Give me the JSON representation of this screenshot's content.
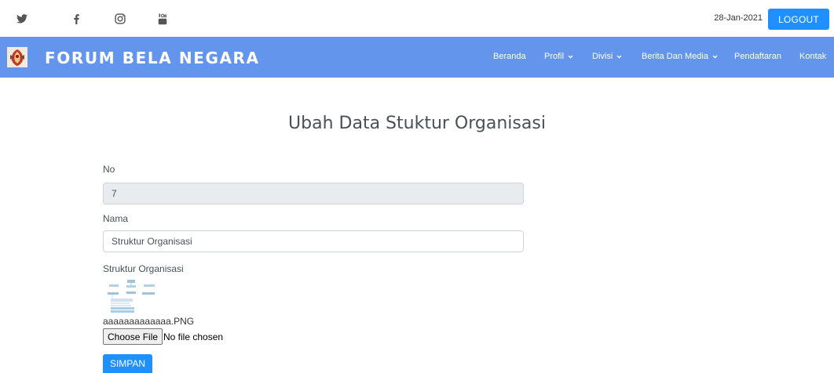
{
  "topbar": {
    "social_icons": [
      "twitter-icon",
      "facebook-icon",
      "instagram-icon",
      "youtube-icon"
    ],
    "date": "28-Jan-2021",
    "logout_label": "LOGOUT"
  },
  "navbar": {
    "brand": "FORUM BELA NEGARA",
    "items": [
      {
        "label": "Beranda",
        "dropdown": false
      },
      {
        "label": "Profil",
        "dropdown": true
      },
      {
        "label": "Divisi",
        "dropdown": true
      },
      {
        "label": "Berita Dan Media",
        "dropdown": true
      },
      {
        "label": "Pendaftaran",
        "dropdown": false
      },
      {
        "label": "Kontak",
        "dropdown": false
      }
    ],
    "colors": {
      "background": "#6495ed",
      "text": "#ffffff"
    }
  },
  "form": {
    "title": "Ubah Data Stuktur Organisasi",
    "no_label": "No",
    "no_value": "7",
    "nama_label": "Nama",
    "nama_value": "Struktur Organisasi",
    "struktur_label": "Struktur Organisasi",
    "current_file": "aaaaaaaaaaaaa.PNG",
    "choose_file_label": "Choose File",
    "no_file_text": "No file chosen",
    "submit_label": "SIMPAN"
  },
  "colors": {
    "accent": "#1e90ff",
    "readonly_bg": "#e9ecef"
  }
}
